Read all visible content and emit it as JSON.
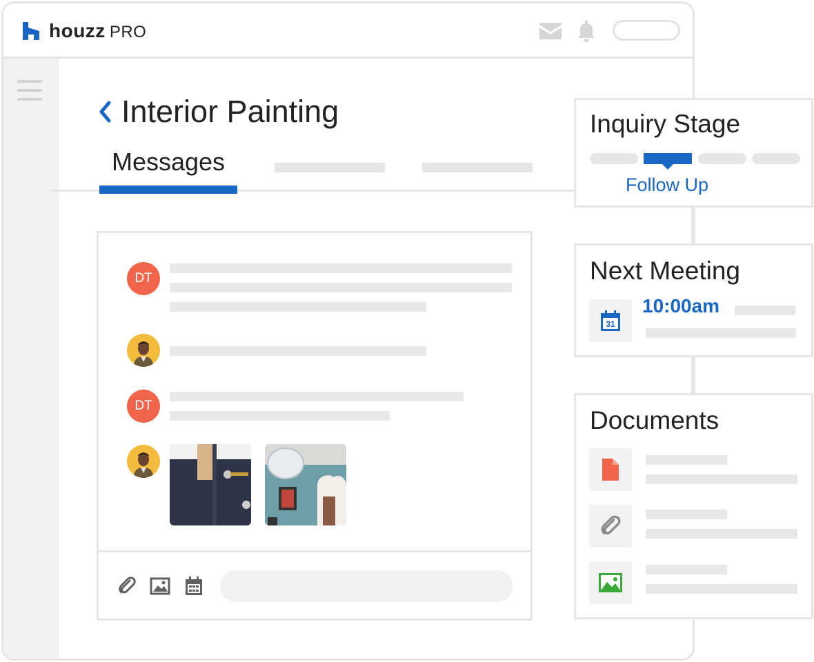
{
  "brand": {
    "name": "houzz",
    "suffix": "PRO"
  },
  "header": {
    "icons": [
      "mail-icon",
      "bell-icon"
    ]
  },
  "page": {
    "title": "Interior Painting"
  },
  "tabs": [
    {
      "label": "Messages",
      "active": true
    }
  ],
  "messages": [
    {
      "avatar": "DT"
    },
    {
      "avatar": "photo"
    },
    {
      "avatar": "DT"
    },
    {
      "avatar": "photo",
      "attachments": 2
    }
  ],
  "composer": {
    "icons": [
      "paperclip-icon",
      "image-icon",
      "calendar-icon"
    ]
  },
  "inquiry_stage": {
    "title": "Inquiry Stage",
    "current": "Follow Up",
    "total_steps": 4,
    "current_step": 2
  },
  "next_meeting": {
    "title": "Next Meeting",
    "time": "10:00am",
    "calendar_day": "31"
  },
  "documents": {
    "title": "Documents",
    "icons": [
      "file-icon",
      "paperclip-icon",
      "image-icon"
    ]
  },
  "colors": {
    "accent": "#1a66c4",
    "avatar_dt": "#f2654a",
    "avatar_photo": "#f4bc3d",
    "border": "#e6e6e6"
  }
}
